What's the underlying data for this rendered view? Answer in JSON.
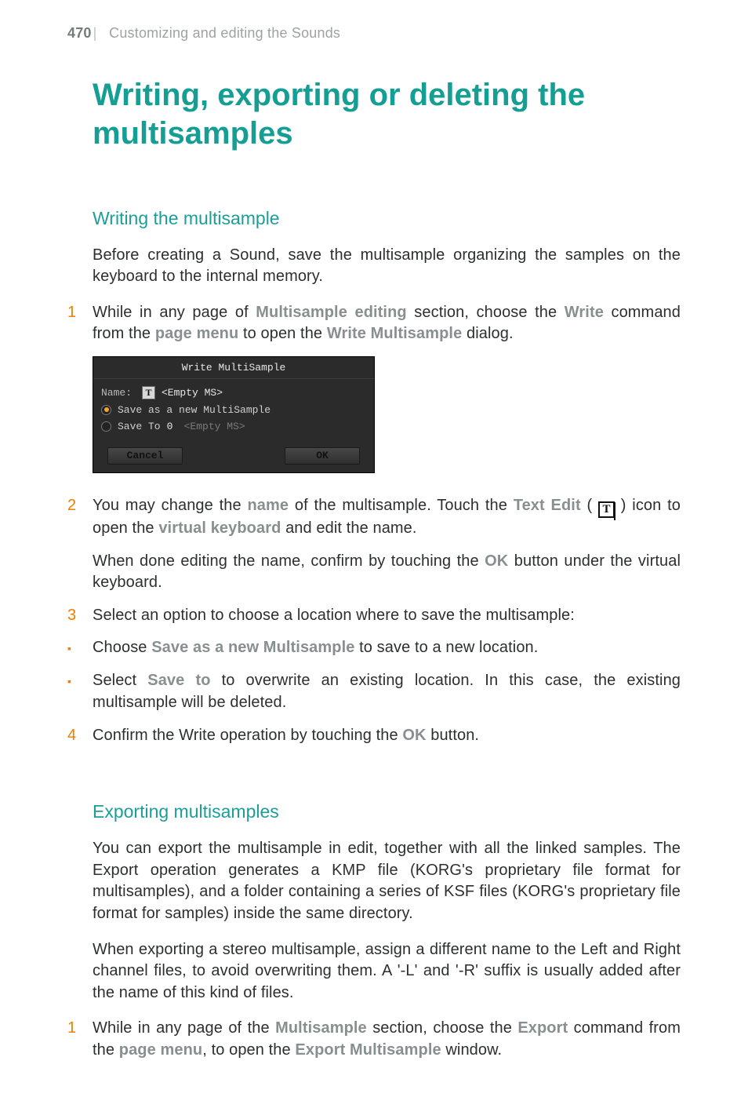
{
  "header": {
    "page_number": "470",
    "separator": "|",
    "chapter": "Customizing and editing the Sounds"
  },
  "title": "Writing, exporting or deleting the multisamples",
  "section_writing": {
    "heading": "Writing the multisample",
    "intro": "Before creating a Sound, save the multisample organizing the samples on the keyboard to the internal memory.",
    "step1": {
      "num": "1",
      "pre": "While in any page of ",
      "bold1": "Multisample editing",
      "mid1": " section, choose the ",
      "bold2": "Write",
      "mid2": " com­mand from the ",
      "bold3": "page menu",
      "mid3": " to open the ",
      "bold4": "Write Multisample",
      "post": " dialog."
    },
    "dialog": {
      "title": "Write MultiSample",
      "name_label": "Name:",
      "t_btn": "T",
      "name_value": "<Empty MS>",
      "opt_new": "Save as a new MultiSample",
      "opt_saveto_label": "Save To",
      "opt_saveto_index": "0",
      "opt_saveto_value": "<Empty MS>",
      "cancel": "Cancel",
      "ok": "OK"
    },
    "step2": {
      "num": "2",
      "p1_pre": "You may change the ",
      "p1_bold1": "name",
      "p1_mid1": " of the multisample. Touch the ",
      "p1_bold2": "Text Edit",
      "p1_mid2": " ( ",
      "p1_icon_label": "T",
      "p1_mid3": " ) icon to open the ",
      "p1_bold3": "virtual keyboard",
      "p1_post": " and edit the name.",
      "p2_pre": "When done editing the name, confirm by touching the ",
      "p2_bold1": "OK",
      "p2_post": " button under the virtual keyboard."
    },
    "step3": {
      "num": "3",
      "text": "Select an option to choose a location where to save the multisample:"
    },
    "bullet_a": {
      "pre": "Choose ",
      "bold": "Save as a new Multisample",
      "post": " to save to a new location."
    },
    "bullet_b": {
      "pre": "Select ",
      "bold": "Save to",
      "post": " to overwrite an existing location. In this case, the existing multisample will be deleted."
    },
    "step4": {
      "num": "4",
      "pre": "Confirm the Write operation by touching the ",
      "bold": "OK",
      "post": " button."
    }
  },
  "section_exporting": {
    "heading": "Exporting multisamples",
    "para1": "You can export the multisample in edit, together with all the linked samples. The Export operation generates a KMP file (KORG's proprietary file format for multisamples), and a folder containing a series of KSF files (KORG's pro­prietary file format for samples) inside the same directory.",
    "para2": "When exporting a stereo multisample, assign a different name to the Left and Right channel files, to avoid overwriting them. A '-L' and '-R' suffix is usu­ally added after the name of this kind of files.",
    "step1": {
      "num": "1",
      "pre": "While in any page of the ",
      "bold1": "Multisample",
      "mid1": " section, choose the ",
      "bold2": "Export",
      "mid2": " command from the ",
      "bold3": "page menu",
      "mid3": ", to open the ",
      "bold4": "Export Multisample",
      "post": " window."
    }
  }
}
